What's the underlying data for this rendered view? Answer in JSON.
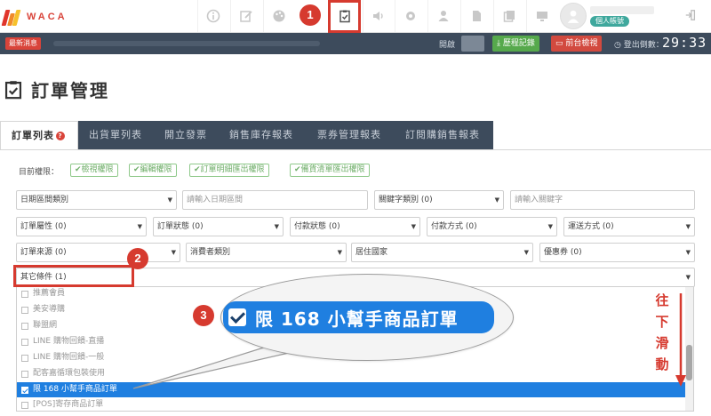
{
  "brand": {
    "name": "WACA",
    "colors": {
      "accent": "#d9443a",
      "primary": "#1f7fe0",
      "dark_bar": "#3d4b5c"
    }
  },
  "topnav": {
    "icons": [
      "info-icon",
      "edit-icon",
      "palette-icon",
      "order-clipboard-icon",
      "volume-icon",
      "settings-icon",
      "user-icon",
      "document-icon",
      "copy-icon",
      "monitor-icon"
    ],
    "user_badge": "個人帳號",
    "logout_icon": "logout-icon"
  },
  "statusbar": {
    "news_tag": "最新消息",
    "open_label": "開啟",
    "history_button": "歷程記錄",
    "front_button": "前台檢視",
    "logout_count_label": "登出倒數：",
    "timer": "29:33"
  },
  "page": {
    "title": "訂單管理"
  },
  "tabs": [
    {
      "label": "訂單列表",
      "active": true
    },
    {
      "label": "出貨單列表",
      "active": false
    },
    {
      "label": "開立發票",
      "active": false
    },
    {
      "label": "銷售庫存報表",
      "active": false
    },
    {
      "label": "票券管理報表",
      "active": false
    },
    {
      "label": "訂閱購銷售報表",
      "active": false
    }
  ],
  "permissions": {
    "label": "目前權限：",
    "items": [
      "檢視權限",
      "編輯權限",
      "訂單明細匯出權限",
      "備貨清單匯出權限"
    ]
  },
  "filters": {
    "date_type": "日期區間類別",
    "date_placeholder": "請輸入日期區間",
    "keyword_type": "關鍵字類別 (0)",
    "keyword_placeholder": "請輸入關鍵字",
    "order_attr": "訂單屬性 (0)",
    "order_status": "訂單狀態 (0)",
    "payment_status": "付款狀態 (0)",
    "payment_method": "付款方式 (0)",
    "shipping_method": "運送方式 (0)",
    "order_source": "訂單來源 (0)",
    "consumer_type": "消費者類別",
    "country": "居住國家",
    "coupon": "優惠券 (0)",
    "other": "其它條件 (1)"
  },
  "other_options": [
    {
      "label": "推薦會員",
      "checked": false
    },
    {
      "label": "美安導購",
      "checked": false
    },
    {
      "label": "聯盟網",
      "checked": false
    },
    {
      "label": "LINE 購物回饋-直播",
      "checked": false
    },
    {
      "label": "LINE 購物回饋-一般",
      "checked": false
    },
    {
      "label": "配客嘉循環包裝使用",
      "checked": false
    },
    {
      "label": "限 168 小幫手商品訂單",
      "checked": true
    },
    {
      "label": "[POS]寄存商品訂單",
      "checked": false
    }
  ],
  "annotations": {
    "step1": "1",
    "step2": "2",
    "step3": "3",
    "zoom_text": "限 168 小幫手商品訂單",
    "scroll_hint": [
      "往",
      "下",
      "滑",
      "動"
    ]
  }
}
